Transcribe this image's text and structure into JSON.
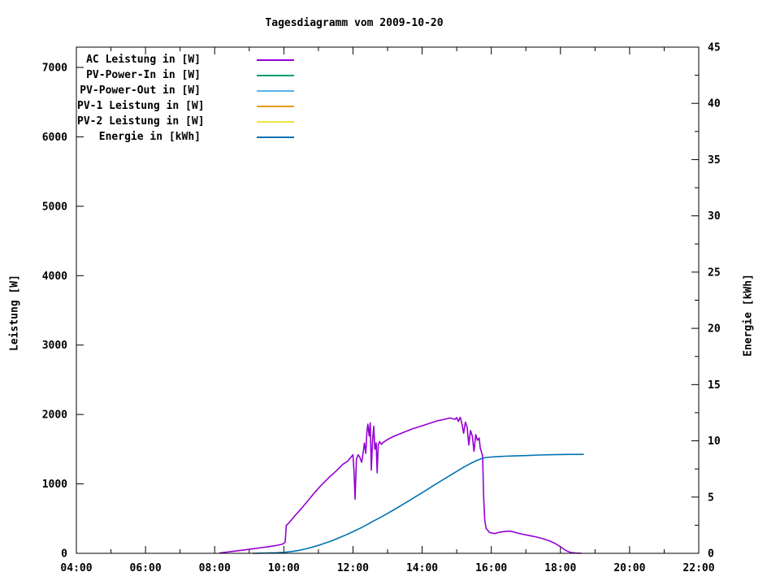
{
  "window": {
    "background": "#ffffff",
    "foreground": "#000000"
  },
  "chart_data": {
    "type": "line",
    "title": "Tagesdiagramm vom 2009-10-20",
    "grid": false,
    "legend_position": "top-left-inside",
    "x_axis": {
      "ticks": [
        {
          "v": 4,
          "label": "04:00"
        },
        {
          "v": 6,
          "label": "06:00"
        },
        {
          "v": 8,
          "label": "08:00"
        },
        {
          "v": 10,
          "label": "10:00"
        },
        {
          "v": 12,
          "label": "12:00"
        },
        {
          "v": 14,
          "label": "14:00"
        },
        {
          "v": 16,
          "label": "16:00"
        },
        {
          "v": 18,
          "label": "18:00"
        },
        {
          "v": 20,
          "label": "20:00"
        },
        {
          "v": 22,
          "label": "22:00"
        }
      ],
      "minor_ticks": [
        5,
        7,
        9,
        11,
        13,
        15,
        17,
        19,
        21
      ],
      "min": 4,
      "max": 22
    },
    "y_left": {
      "title": "Leistung [W]",
      "min": 0,
      "max": 7300,
      "ticks": [
        {
          "v": 0,
          "label": "0"
        },
        {
          "v": 1000,
          "label": "1000"
        },
        {
          "v": 2000,
          "label": "2000"
        },
        {
          "v": 3000,
          "label": "3000"
        },
        {
          "v": 4000,
          "label": "4000"
        },
        {
          "v": 5000,
          "label": "5000"
        },
        {
          "v": 6000,
          "label": "6000"
        },
        {
          "v": 7000,
          "label": "7000"
        }
      ]
    },
    "y_right": {
      "title": "Energie [kWh]",
      "min": 0,
      "max": 45,
      "ticks": [
        {
          "v": 0,
          "label": "0"
        },
        {
          "v": 5,
          "label": "5"
        },
        {
          "v": 10,
          "label": "10"
        },
        {
          "v": 15,
          "label": "15"
        },
        {
          "v": 20,
          "label": "20"
        },
        {
          "v": 25,
          "label": "25"
        },
        {
          "v": 30,
          "label": "30"
        },
        {
          "v": 35,
          "label": "35"
        },
        {
          "v": 40,
          "label": "40"
        },
        {
          "v": 45,
          "label": "45"
        }
      ],
      "minor_ticks": [
        2.5,
        7.5,
        12.5,
        17.5,
        22.5,
        27.5,
        32.5,
        37.5,
        42.5
      ]
    },
    "series": [
      {
        "name": "AC Leistung in [W]",
        "color": "#9400D3",
        "axis": "left",
        "points": [
          [
            8.15,
            5
          ],
          [
            8.35,
            18
          ],
          [
            8.55,
            30
          ],
          [
            8.75,
            42
          ],
          [
            8.95,
            55
          ],
          [
            9.15,
            68
          ],
          [
            9.35,
            82
          ],
          [
            9.55,
            95
          ],
          [
            9.75,
            110
          ],
          [
            9.95,
            130
          ],
          [
            10.0,
            145
          ],
          [
            10.04,
            160
          ],
          [
            10.07,
            400
          ],
          [
            10.15,
            440
          ],
          [
            10.3,
            530
          ],
          [
            10.5,
            640
          ],
          [
            10.7,
            760
          ],
          [
            10.9,
            880
          ],
          [
            11.1,
            990
          ],
          [
            11.3,
            1090
          ],
          [
            11.5,
            1180
          ],
          [
            11.7,
            1280
          ],
          [
            11.85,
            1330
          ],
          [
            11.95,
            1390
          ],
          [
            12.0,
            1420
          ],
          [
            12.03,
            1180
          ],
          [
            12.06,
            780
          ],
          [
            12.1,
            1360
          ],
          [
            12.15,
            1420
          ],
          [
            12.2,
            1380
          ],
          [
            12.25,
            1310
          ],
          [
            12.3,
            1470
          ],
          [
            12.33,
            1590
          ],
          [
            12.37,
            1440
          ],
          [
            12.4,
            1740
          ],
          [
            12.43,
            1860
          ],
          [
            12.47,
            1690
          ],
          [
            12.5,
            1880
          ],
          [
            12.53,
            1200
          ],
          [
            12.57,
            1650
          ],
          [
            12.6,
            1830
          ],
          [
            12.63,
            1500
          ],
          [
            12.67,
            1590
          ],
          [
            12.7,
            1160
          ],
          [
            12.73,
            1560
          ],
          [
            12.77,
            1610
          ],
          [
            12.82,
            1570
          ],
          [
            12.88,
            1600
          ],
          [
            13.0,
            1640
          ],
          [
            13.2,
            1690
          ],
          [
            13.45,
            1740
          ],
          [
            13.7,
            1790
          ],
          [
            13.95,
            1830
          ],
          [
            14.2,
            1870
          ],
          [
            14.45,
            1910
          ],
          [
            14.65,
            1930
          ],
          [
            14.8,
            1950
          ],
          [
            14.95,
            1930
          ],
          [
            15.0,
            1955
          ],
          [
            15.05,
            1900
          ],
          [
            15.1,
            1960
          ],
          [
            15.15,
            1870
          ],
          [
            15.2,
            1730
          ],
          [
            15.25,
            1890
          ],
          [
            15.3,
            1820
          ],
          [
            15.35,
            1560
          ],
          [
            15.4,
            1770
          ],
          [
            15.45,
            1690
          ],
          [
            15.5,
            1470
          ],
          [
            15.55,
            1710
          ],
          [
            15.6,
            1630
          ],
          [
            15.65,
            1660
          ],
          [
            15.68,
            1520
          ],
          [
            15.72,
            1450
          ],
          [
            15.75,
            1400
          ],
          [
            15.78,
            800
          ],
          [
            15.81,
            480
          ],
          [
            15.85,
            360
          ],
          [
            15.95,
            300
          ],
          [
            16.1,
            285
          ],
          [
            16.25,
            305
          ],
          [
            16.4,
            315
          ],
          [
            16.55,
            320
          ],
          [
            16.7,
            300
          ],
          [
            16.9,
            275
          ],
          [
            17.1,
            255
          ],
          [
            17.3,
            235
          ],
          [
            17.5,
            210
          ],
          [
            17.7,
            175
          ],
          [
            17.85,
            140
          ],
          [
            18.0,
            95
          ],
          [
            18.1,
            60
          ],
          [
            18.2,
            30
          ],
          [
            18.3,
            12
          ],
          [
            18.45,
            4
          ],
          [
            18.6,
            0
          ]
        ]
      },
      {
        "name": "PV-Power-In in [W]",
        "color": "#009E73",
        "axis": "left",
        "points": []
      },
      {
        "name": "PV-Power-Out in [W]",
        "color": "#56B4E9",
        "axis": "left",
        "points": []
      },
      {
        "name": "PV-1 Leistung in [W]",
        "color": "#E69F00",
        "axis": "left",
        "points": []
      },
      {
        "name": "PV-2 Leistung in [W]",
        "color": "#F0E442",
        "axis": "left",
        "points": []
      },
      {
        "name": "Energie in [kWh]",
        "color": "#0072B2",
        "axis": "right",
        "points": [
          [
            9.1,
            0
          ],
          [
            9.5,
            0.02
          ],
          [
            9.8,
            0.05
          ],
          [
            10.0,
            0.09
          ],
          [
            10.2,
            0.15
          ],
          [
            10.4,
            0.24
          ],
          [
            10.6,
            0.37
          ],
          [
            10.8,
            0.53
          ],
          [
            11.0,
            0.71
          ],
          [
            11.2,
            0.91
          ],
          [
            11.4,
            1.13
          ],
          [
            11.6,
            1.38
          ],
          [
            11.8,
            1.64
          ],
          [
            12.0,
            1.92
          ],
          [
            12.2,
            2.22
          ],
          [
            12.4,
            2.54
          ],
          [
            12.6,
            2.88
          ],
          [
            12.8,
            3.2
          ],
          [
            13.0,
            3.55
          ],
          [
            13.2,
            3.9
          ],
          [
            13.4,
            4.27
          ],
          [
            13.6,
            4.64
          ],
          [
            13.8,
            5.01
          ],
          [
            14.0,
            5.39
          ],
          [
            14.2,
            5.77
          ],
          [
            14.4,
            6.16
          ],
          [
            14.6,
            6.54
          ],
          [
            14.8,
            6.91
          ],
          [
            15.0,
            7.28
          ],
          [
            15.2,
            7.65
          ],
          [
            15.4,
            7.99
          ],
          [
            15.6,
            8.28
          ],
          [
            15.75,
            8.45
          ],
          [
            15.85,
            8.52
          ],
          [
            16.0,
            8.56
          ],
          [
            16.2,
            8.6
          ],
          [
            16.4,
            8.63
          ],
          [
            16.7,
            8.66
          ],
          [
            17.0,
            8.69
          ],
          [
            17.4,
            8.74
          ],
          [
            17.8,
            8.77
          ],
          [
            18.2,
            8.79
          ],
          [
            18.66,
            8.8
          ]
        ]
      }
    ]
  }
}
